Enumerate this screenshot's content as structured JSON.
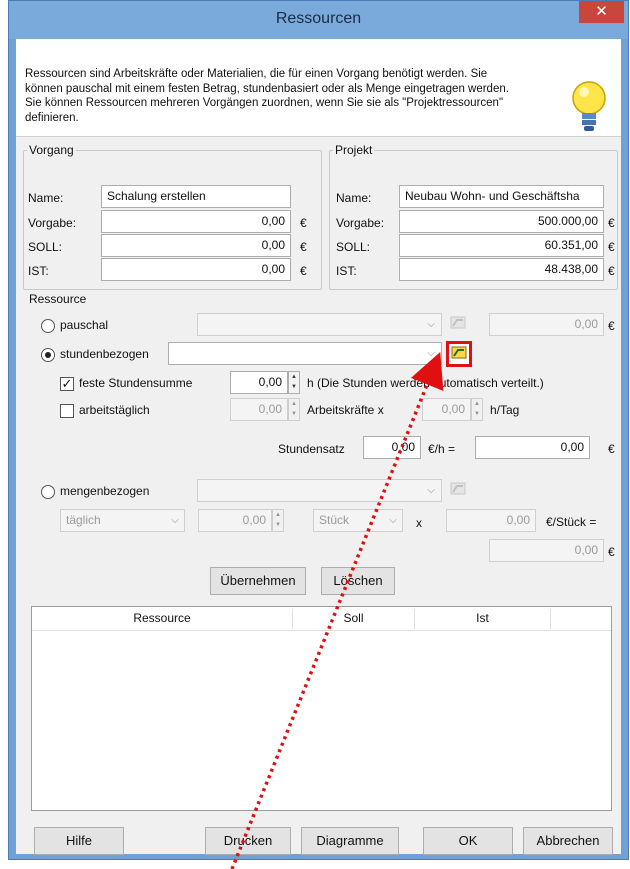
{
  "window": {
    "title": "Ressourcen",
    "close_label": "✕"
  },
  "info": {
    "text": "Ressourcen sind Arbeitskräfte oder Materialien, die für einen Vorgang benötigt werden. Sie können pauschal mit einem festen Betrag, stundenbasiert oder als Menge eingetragen werden. Sie können Ressourcen mehreren Vorgängen zuordnen, wenn Sie sie als \"Projektressourcen\" definieren."
  },
  "vorgang": {
    "legend": "Vorgang",
    "name_label": "Name:",
    "name_value": "Schalung erstellen",
    "vorgabe_label": "Vorgabe:",
    "vorgabe_value": "0,00",
    "soll_label": "SOLL:",
    "soll_value": "0,00",
    "ist_label": "IST:",
    "ist_value": "0,00",
    "currency": "€"
  },
  "projekt": {
    "legend": "Projekt",
    "name_label": "Name:",
    "name_value": "Neubau Wohn- und Geschäftsha",
    "vorgabe_label": "Vorgabe:",
    "vorgabe_value": "500.000,00",
    "soll_label": "SOLL:",
    "soll_value": "60.351,00",
    "ist_label": "IST:",
    "ist_value": "48.438,00",
    "currency": "€"
  },
  "ressource": {
    "legend": "Ressource",
    "pauschal_label": "pauschal",
    "pauschal_value": "0,00",
    "stunden_label": "stundenbezogen",
    "feste_label": "feste Stundensumme",
    "feste_value": "0,00",
    "h_note": "h  (Die Stunden werden automatisch verteilt.)",
    "arbeitstaeglich_label": "arbeitstäglich",
    "arbeitstaeglich_value": "0,00",
    "arbeitskraefte_label": "Arbeitskräfte x",
    "arbeitskraefte_value": "0,00",
    "h_tag_label": "h/Tag",
    "stundensatz_label": "Stundensatz",
    "stundensatz_value": "0,00",
    "eur_h_label": "€/h =",
    "stundensatz_total": "0,00",
    "menge_label": "mengenbezogen",
    "interval_value": "täglich",
    "interval_amount": "0,00",
    "unit_value": "Stück",
    "x_label": "x",
    "unit_price": "0,00",
    "per_unit_label": "€/Stück =",
    "menge_total": "0,00",
    "currency": "€"
  },
  "actions": {
    "apply_label": "Übernehmen",
    "delete_label": "Löschen"
  },
  "table": {
    "headers": [
      "Ressource",
      "Soll",
      "Ist"
    ]
  },
  "footer": {
    "help_label": "Hilfe",
    "print_label": "Drucken",
    "chart_label": "Diagramme",
    "ok_label": "OK",
    "cancel_label": "Abbrechen"
  },
  "colors": {
    "annotation": "#e01010",
    "titlebar": "#7aa9dc",
    "close": "#c9463d"
  }
}
